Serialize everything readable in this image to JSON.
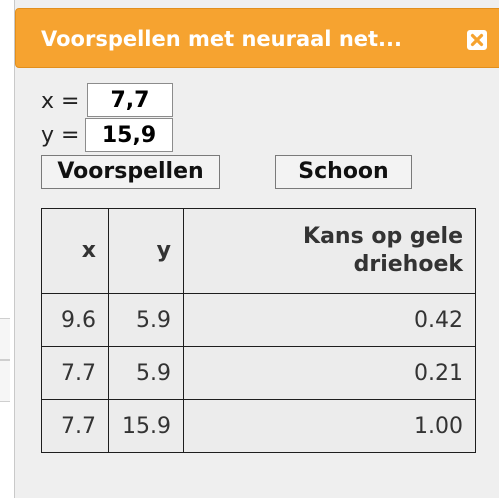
{
  "dialog": {
    "title": "Voorspellen met neuraal net...",
    "close_icon": "close-icon",
    "colors": {
      "titlebar": "#f6a330",
      "title_text": "#ffffff"
    }
  },
  "inputs": {
    "x_label": "x =",
    "x_value": "7,7",
    "y_label": "y =",
    "y_value": "15,9"
  },
  "buttons": {
    "predict_label": "Voorspellen",
    "clear_label": "Schoon"
  },
  "table": {
    "headers": [
      "x",
      "y",
      "Kans op gele driehoek"
    ],
    "rows": [
      [
        "9.6",
        "5.9",
        "0.42"
      ],
      [
        "7.7",
        "5.9",
        "0.21"
      ],
      [
        "7.7",
        "15.9",
        "1.00"
      ]
    ]
  }
}
